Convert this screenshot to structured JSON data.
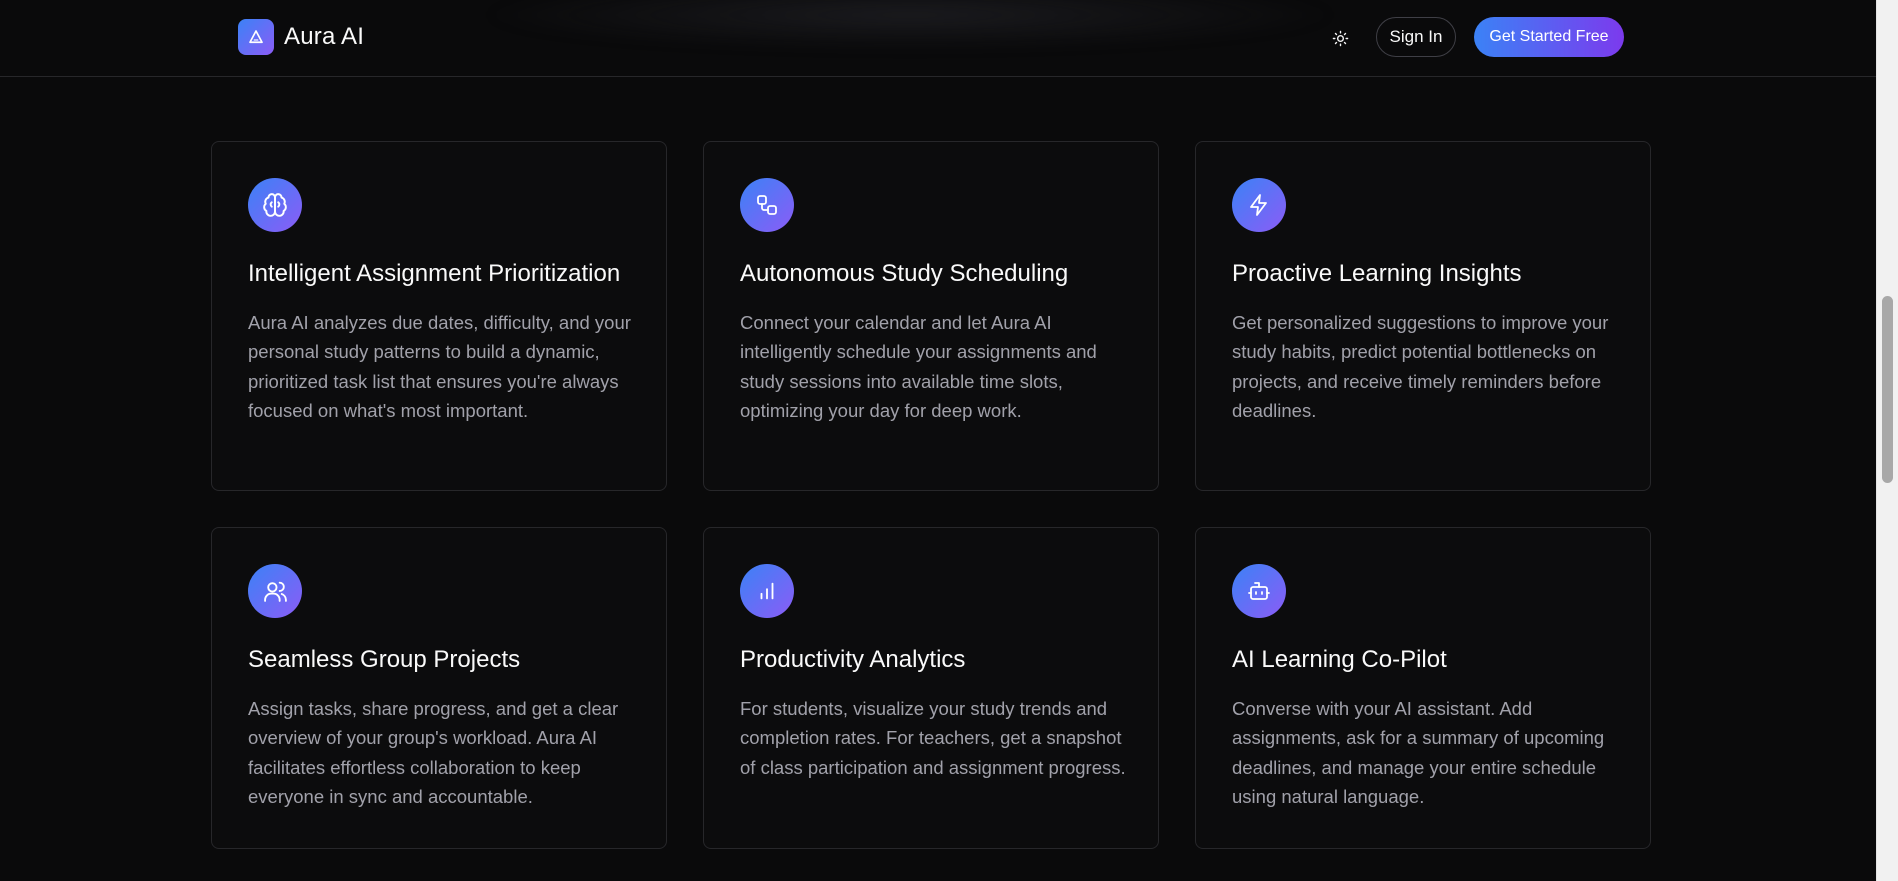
{
  "header": {
    "brand_name": "Aura AI",
    "logo_icon": "triangle-logo-icon",
    "theme_toggle_icon": "sun-icon",
    "signin_label": "Sign In",
    "cta_label": "Get Started Free"
  },
  "features": [
    {
      "icon": "brain-icon",
      "title": "Intelligent Assignment Prioritization",
      "description": "Aura AI analyzes due dates, difficulty, and your personal study patterns to build a dynamic, prioritized task list that ensures you're always focused on what's most important."
    },
    {
      "icon": "workflow-icon",
      "title": "Autonomous Study Scheduling",
      "description": "Connect your calendar and let Aura AI intelligently schedule your assignments and study sessions into available time slots, optimizing your day for deep work."
    },
    {
      "icon": "lightning-icon",
      "title": "Proactive Learning Insights",
      "description": "Get personalized suggestions to improve your study habits, predict potential bottlenecks on projects, and receive timely reminders before deadlines."
    },
    {
      "icon": "users-icon",
      "title": "Seamless Group Projects",
      "description": "Assign tasks, share progress, and get a clear overview of your group's workload. Aura AI facilitates effortless collaboration to keep everyone in sync and accountable."
    },
    {
      "icon": "bar-chart-icon",
      "title": "Productivity Analytics",
      "description": "For students, visualize your study trends and completion rates. For teachers, get a snapshot of class participation and assignment progress."
    },
    {
      "icon": "bot-icon",
      "title": "AI Learning Co-Pilot",
      "description": "Converse with your AI assistant. Add assignments, ask for a summary of upcoming deadlines, and manage your entire schedule using natural language."
    }
  ],
  "colors": {
    "background": "#0a0a0b",
    "accent_start": "#3b82f6",
    "accent_end": "#8b5cf6",
    "card_border": "#27272a",
    "muted_text": "#a1a1aa"
  }
}
